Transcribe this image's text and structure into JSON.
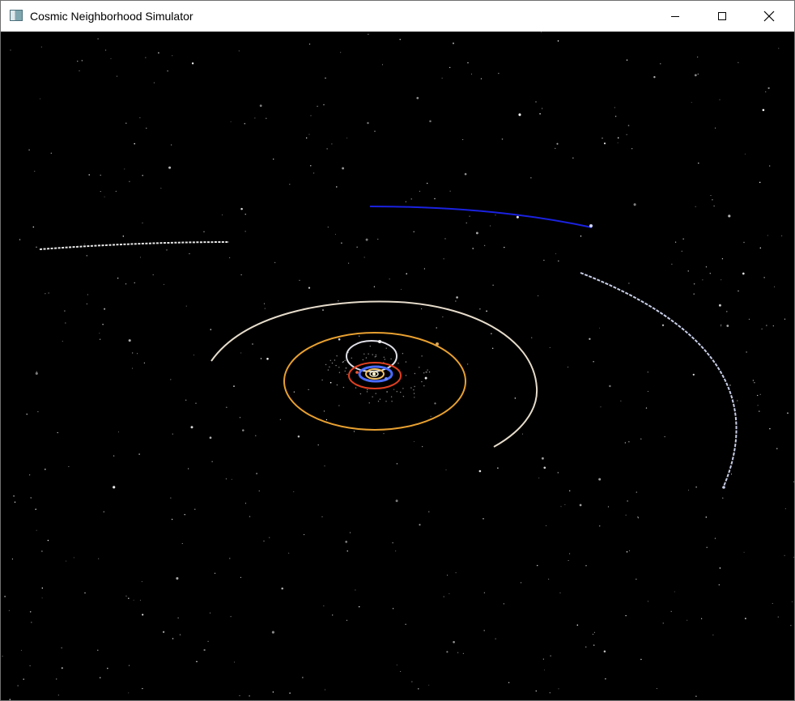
{
  "window": {
    "title": "Cosmic Neighborhood Simulator",
    "icon": "app-window-icon",
    "controls": [
      {
        "name": "minimize-button",
        "icon": "minimize-icon"
      },
      {
        "name": "maximize-button",
        "icon": "maximize-icon"
      },
      {
        "name": "close-button",
        "icon": "close-icon"
      }
    ]
  },
  "scene": {
    "background": "#000000",
    "orbit_colors": {
      "mercury": "#e8e0c0",
      "venus": "#f0c060",
      "earth": "#4a6cff",
      "mars": "#e04020",
      "jupiter": "#e0e0e8",
      "saturn": "#e8a030",
      "uranus": "#e6dccb",
      "neptune": "#c8cee8",
      "pluto": "#e8e8e8",
      "comet": "#1a22e0"
    }
  }
}
